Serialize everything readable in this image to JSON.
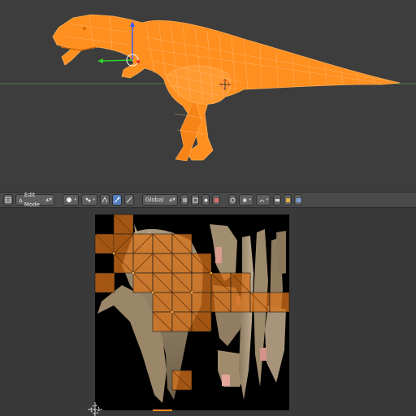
{
  "header": {
    "mode_label": "Edit Mode",
    "pivot_label": "Global"
  },
  "icons": {
    "editor_type": "uv-image-editor-icon",
    "sphere": "viewport-shading-icon",
    "pivot": "pivot-point-icon",
    "sync": "uv-sync-selection-icon",
    "vertex_select": "vertex-select-icon",
    "edge_select": "edge-select-icon",
    "face_select": "face-select-icon",
    "island_select": "island-select-icon",
    "snap": "snap-icon",
    "proportional": "proportional-edit-icon",
    "render": "render-icon",
    "image_browse": "image-browse-icon"
  },
  "colors": {
    "selection_orange": "#ff8c1a",
    "uv_face_fill": "#d9731a",
    "viewport_bg": "#3d3d3d",
    "header_bg": "#4a4a4a",
    "accent_blue": "#5680c2"
  }
}
